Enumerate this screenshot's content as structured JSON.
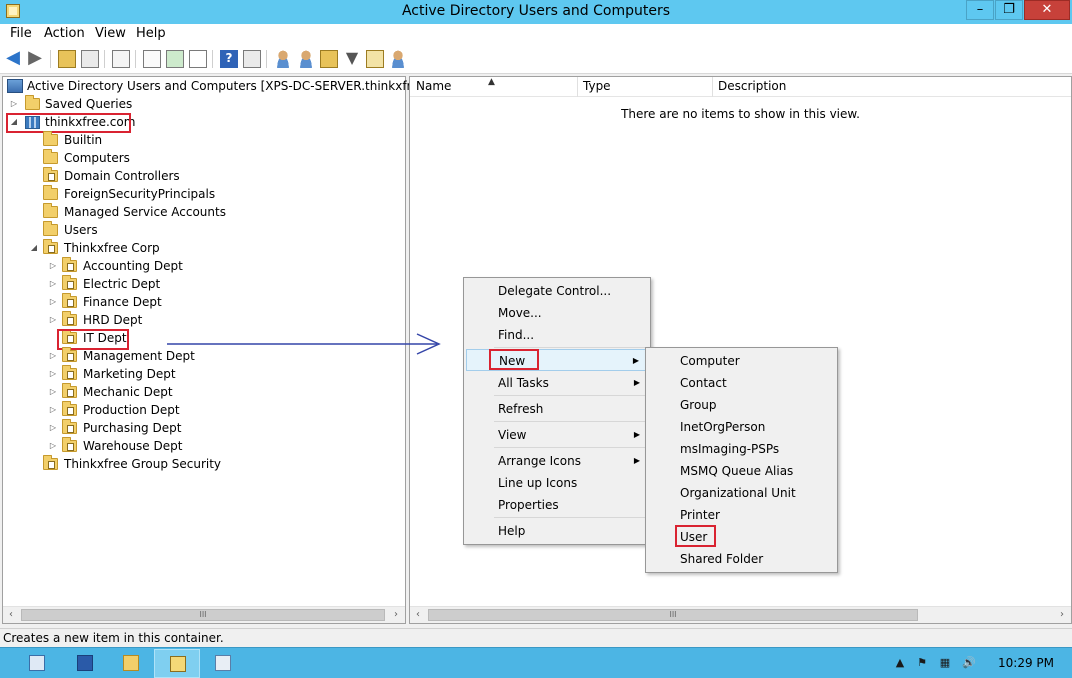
{
  "window": {
    "title": "Active Directory Users and Computers",
    "controls": {
      "minimize": "–",
      "maximize": "❐",
      "close": "✕"
    }
  },
  "menu": [
    "File",
    "Action",
    "View",
    "Help"
  ],
  "toolbar": {
    "icons": [
      "back-arrow-icon",
      "forward-arrow-icon",
      "up-folder-icon",
      "show-hide-tree-icon",
      "clipboard-icon",
      "export-list-icon",
      "refresh-icon",
      "export-icon",
      "help-icon",
      "properties-icon",
      "new-user-icon",
      "new-group-icon",
      "new-ou-icon",
      "filter-icon",
      "find-icon",
      "add-to-group-icon"
    ],
    "help_glyph": "?"
  },
  "tree": {
    "root": "Active Directory Users and Computers [XPS-DC-SERVER.thinkxfree.com]",
    "saved_queries": "Saved Queries",
    "domain": "thinkxfree.com",
    "containers": [
      "Builtin",
      "Computers",
      "Domain Controllers",
      "ForeignSecurityPrincipals",
      "Managed Service Accounts",
      "Users"
    ],
    "corp": "Thinkxfree Corp",
    "depts": [
      "Accounting Dept",
      "Electric Dept",
      "Finance Dept",
      "HRD Dept",
      "IT Dept",
      "Management Dept",
      "Marketing Dept",
      "Mechanic Dept",
      "Production Dept",
      "Purchasing Dept",
      "Warehouse Dept"
    ],
    "group_security": "Thinkxfree Group Security",
    "expanders": {
      "collapsed": "▷",
      "expanded": "◢"
    }
  },
  "list": {
    "columns": [
      "Name",
      "Type",
      "Description"
    ],
    "sort_glyph": "▲",
    "empty_message": "There are no items to show in this view."
  },
  "scroll": {
    "left": "‹",
    "right": "›",
    "grip": "III"
  },
  "context_menu": {
    "items": [
      "Delegate Control...",
      "Move...",
      "Find...",
      "New",
      "All Tasks",
      "Refresh",
      "View",
      "Arrange Icons",
      "Line up Icons",
      "Properties",
      "Help"
    ],
    "submenu_glyph": "▶"
  },
  "new_submenu": [
    "Computer",
    "Contact",
    "Group",
    "InetOrgPerson",
    "msImaging-PSPs",
    "MSMQ Queue Alias",
    "Organizational Unit",
    "Printer",
    "User",
    "Shared Folder"
  ],
  "status": "Creates a new item in this container.",
  "taskbar": {
    "clock": "10:29 PM",
    "tray_glyphs": [
      "▲",
      "⚑",
      "▦",
      "🔊"
    ]
  },
  "colors": {
    "title_bar": "#5ec8f0",
    "taskbar": "#4cb5e4",
    "highlight_box": "#d92331",
    "arrow": "#3445a8"
  }
}
